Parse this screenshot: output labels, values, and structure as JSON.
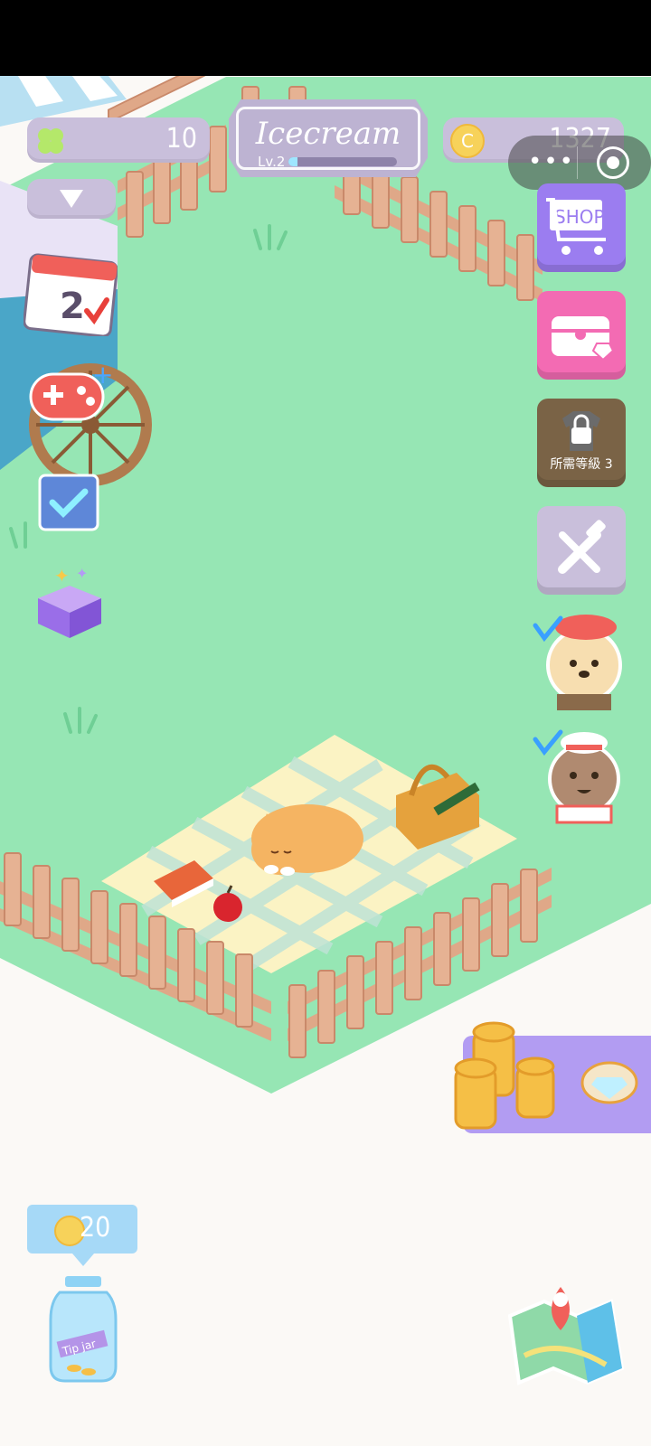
{
  "hud": {
    "clover_count": "10",
    "shop_name": "Icecream",
    "level_label": "Lv.2",
    "level_progress": 0.08,
    "coin_count": "1327",
    "coin_symbol": "C"
  },
  "side_buttons": {
    "shop_label": "SHOP",
    "locked_label": "所需等級 3"
  },
  "calendar_day": "2",
  "tip_jar": {
    "amount": "20",
    "coin_symbol": "C",
    "jar_label": "Tip jar"
  },
  "colors": {
    "grass": "#96e6b4",
    "fence": "#dfa888",
    "shop_button": "#9b7df0",
    "gift_button": "#f36bb3",
    "locked_button": "#7a6346",
    "hud_pill": "#c9bfdb"
  },
  "icons": [
    "clover-icon",
    "dropdown-arrow-icon",
    "calendar-icon",
    "gamepad-icon",
    "checklist-icon",
    "mystery-box-icon",
    "shopping-cart-icon",
    "chest-icon",
    "lock-icon",
    "tools-icon",
    "poodle-npc",
    "cat-chef-npc",
    "coin-stack-icon",
    "diamond-icon",
    "map-pin-icon",
    "tip-jar-icon"
  ]
}
